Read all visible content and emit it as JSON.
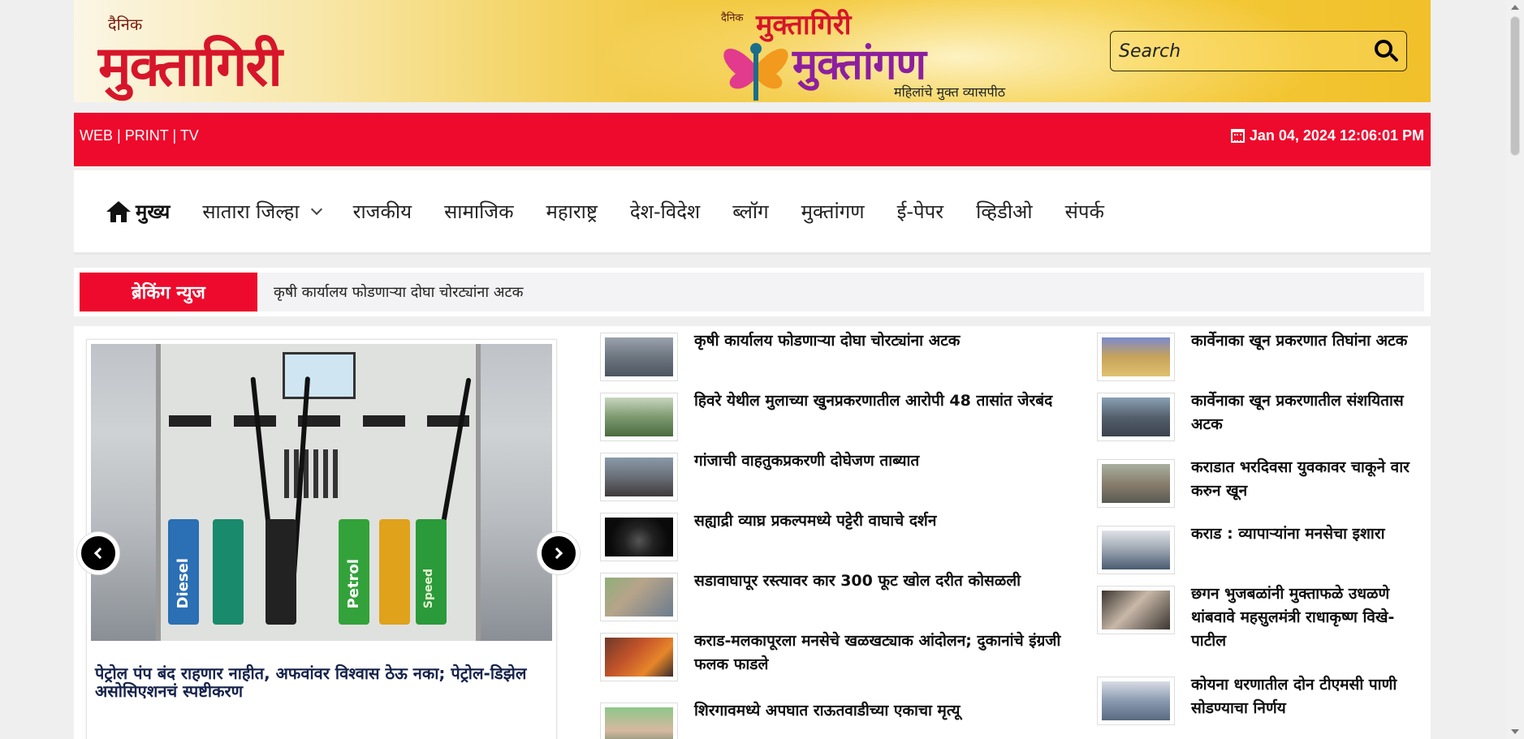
{
  "header": {
    "logo_dainik": "दैनिक",
    "logo_name": "मुक्तागिरी",
    "center_dainik": "दैनिक",
    "center_top_name": "मुक्तागिरी",
    "center_main_name": "मुक्तांगण",
    "center_tagline": "महिलांचे मुक्त व्यासपीठ",
    "search_placeholder": "Search"
  },
  "topbar": {
    "web": "WEB",
    "print": "PRINT",
    "tv": "TV",
    "separator": "|",
    "datetime": "Jan 04, 2024 12:06:01 PM"
  },
  "nav": {
    "home": "मुख्य",
    "items": [
      "सातारा जिल्हा",
      "राजकीय",
      "सामाजिक",
      "महाराष्ट्र",
      "देश-विदेश",
      "ब्लॉग",
      "मुक्तांगण",
      "ई-पेपर",
      "व्हिडीओ",
      "संपर्क"
    ]
  },
  "breaking": {
    "label": "ब्रेकिंग न्युज",
    "ticker": "कृषी कार्यालय फोडणाऱ्या दोघा चोरट्यांना अटक"
  },
  "slider": {
    "caption": "पेट्रोल पंप बंद राहणार नाहीत, अफवांवर विश्वास ठेऊ नका; पेट्रोल-डिझेल असोसिएशनचं स्पष्टीकरण",
    "image_labels": {
      "diesel": "Diesel",
      "petrol": "Petrol",
      "speed": "Speed"
    }
  },
  "news_col1": [
    "कृषी कार्यालय फोडणाऱ्या दोघा चोरट्यांना अटक",
    "हिवरे येथील मुलाच्या खुनप्रकरणातील आरोपी 48 तासांत जेरबंद",
    "गांजाची वाहतुकप्रकरणी दोघेजण ताब्यात",
    "सह्याद्री व्याघ्र प्रकल्पमध्ये पट्टेरी वाघाचे दर्शन",
    "सडावाघापूर रस्त्यावर कार 300 फूट खोल दरीत कोसळली",
    "कराड-मलकापूरला मनसेचे खळखट्याक आंदोलन; दुकानांचे इंग्रजी फलक फाडले",
    "शिरगावमध्ये अपघात राऊतवाडीच्या एकाचा मृत्यू"
  ],
  "news_col2": [
    "कार्वेनाका खून प्रकरणात तिघांना अटक",
    "कार्वेनाका खून प्रकरणातील संशयितास अटक",
    "कराडात भरदिवसा युवकावर चाकूने वार करुन खून",
    "कराड : व्यापाऱ्यांना मनसेचा इशारा",
    "छगन भुजबळांनी मुक्ताफळे उधळणे थांबवावे महसुलमंत्री राधाकृष्ण विखे-पाटील",
    "कोयना धरणातील दोन टीएमसी पाणी सोडण्याचा निर्णय"
  ],
  "colors": {
    "brand_red": "#ee0a2c",
    "caption_navy": "#15224b",
    "header_gold": "#f0c025"
  }
}
